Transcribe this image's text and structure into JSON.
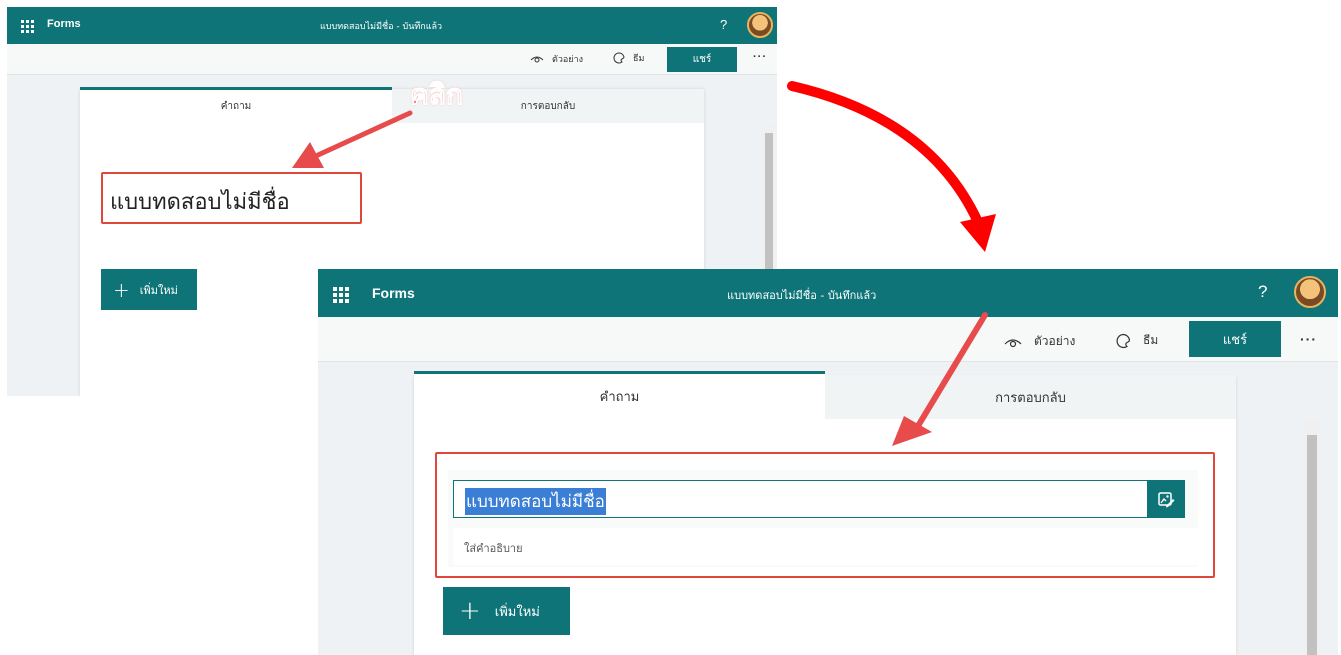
{
  "app": {
    "brand": "Forms",
    "doc_title": "แบบทดสอบไม่มีชื่อ - บันทึกแล้ว",
    "help": "?"
  },
  "toolbar": {
    "preview_label": "ตัวอย่าง",
    "theme_label": "ธีม",
    "share_label": "แชร์",
    "more_label": "···"
  },
  "tabs": {
    "questions": "คำถาม",
    "responses": "การตอบกลับ"
  },
  "form": {
    "title": "แบบทดสอบไม่มีชื่อ",
    "title_input_value": "แบบทดสอบไม่มีชื่อ",
    "description_placeholder": "ใส่คำอธิบาย"
  },
  "actions": {
    "add_new_label": "เพิ่มใหม่"
  },
  "annotation": {
    "click_label": "คลิก"
  },
  "colors": {
    "brand_teal": "#0f7478",
    "annotation_red": "#e0463a",
    "arrow_red": "#ff0000"
  }
}
